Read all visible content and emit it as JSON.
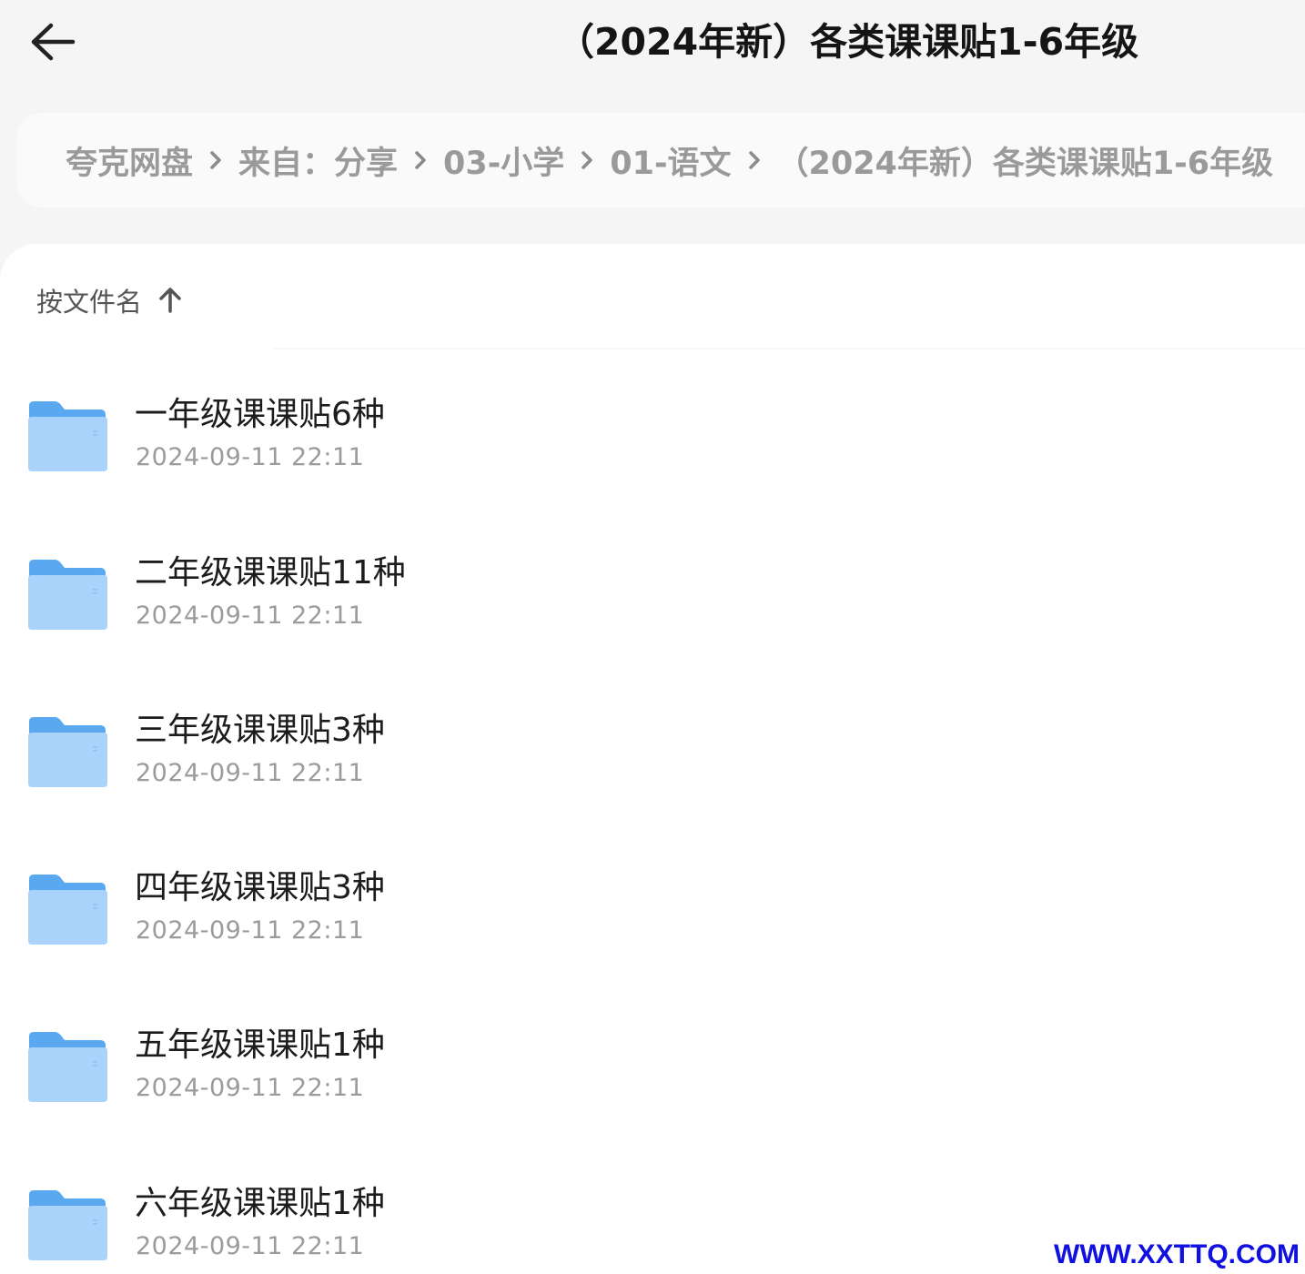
{
  "header": {
    "back_icon": "arrow-left-icon",
    "title": "（2024年新）各类课课贴1-6年级"
  },
  "breadcrumb": {
    "items": [
      "夸克网盘",
      "来自：分享",
      "03-小学",
      "01-语文",
      "（2024年新）各类课课贴1-6年级"
    ],
    "separator_icon": "chevron-right-icon"
  },
  "sort": {
    "label": "按文件名",
    "icon": "arrow-up-icon"
  },
  "files": [
    {
      "name": "一年级课课贴6种",
      "date": "2024-09-11 22:11",
      "icon": "folder-icon"
    },
    {
      "name": "二年级课课贴11种",
      "date": "2024-09-11 22:11",
      "icon": "folder-icon"
    },
    {
      "name": "三年级课课贴3种",
      "date": "2024-09-11 22:11",
      "icon": "folder-icon"
    },
    {
      "name": "四年级课课贴3种",
      "date": "2024-09-11 22:11",
      "icon": "folder-icon"
    },
    {
      "name": "五年级课课贴1种",
      "date": "2024-09-11 22:11",
      "icon": "folder-icon"
    },
    {
      "name": "六年级课课贴1种",
      "date": "2024-09-11 22:11",
      "icon": "folder-icon"
    }
  ],
  "watermark": "WWW.XXTTQ.COM",
  "colors": {
    "background": "#f5f5f6",
    "panel": "#ffffff",
    "folder_back": "#5aa9f0",
    "folder_front": "#a9d3fb"
  }
}
